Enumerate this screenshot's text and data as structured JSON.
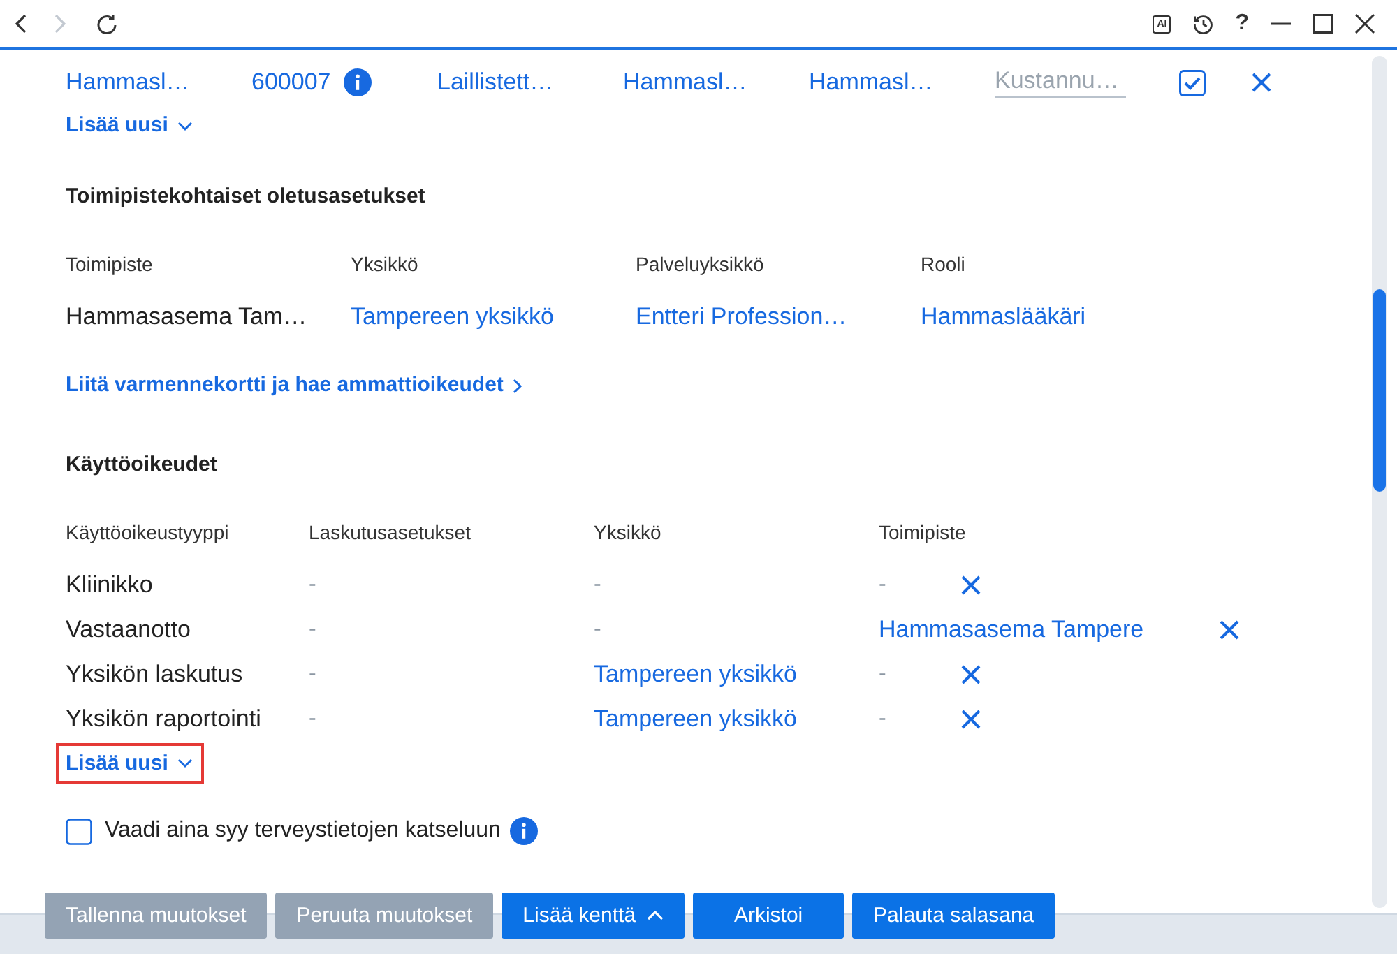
{
  "titlebar": {
    "nav": [
      {
        "kind": "back",
        "disabled": false
      },
      {
        "kind": "forward",
        "disabled": true
      },
      {
        "kind": "refresh",
        "disabled": false
      }
    ],
    "ai_label": "AI",
    "help": "?"
  },
  "top_row": {
    "cells": [
      {
        "text": "Hammasl…",
        "info": false
      },
      {
        "text": "600007",
        "info": true
      },
      {
        "text": "Laillistett…",
        "info": false
      },
      {
        "text": "Hammasl…",
        "info": false
      },
      {
        "text": "Hammasl…",
        "info": false
      }
    ],
    "field": {
      "placeholder": "Kustannu…"
    },
    "checked": true,
    "add_new": "Lisää uusi"
  },
  "default_settings": {
    "title": "Toimipistekohtaiset oletusasetukset",
    "columns": [
      "Toimipiste",
      "Yksikkö",
      "Palveluyksikkö",
      "Rooli"
    ],
    "values": [
      {
        "text": "Hammasasema Tam…",
        "kind": "plain"
      },
      {
        "text": "Tampereen yksikkö",
        "kind": "link"
      },
      {
        "text": "Entteri Profession…",
        "kind": "link"
      },
      {
        "text": "Hammaslääkäri",
        "kind": "link"
      }
    ],
    "link": "Liitä varmennekortti ja hae ammattioikeudet"
  },
  "access_rights": {
    "title": "Käyttöoikeudet",
    "columns": [
      "Käyttöoikeustyyppi",
      "Laskutusasetukset",
      "Yksikkö",
      "Toimipiste"
    ],
    "rows": [
      {
        "cells": [
          {
            "text": "Kliinikko",
            "kind": "plain"
          },
          {
            "text": "-",
            "kind": "dash"
          },
          {
            "text": "-",
            "kind": "dash"
          },
          {
            "text": "-",
            "kind": "dash"
          }
        ]
      },
      {
        "cells": [
          {
            "text": "Vastaanotto",
            "kind": "plain"
          },
          {
            "text": "-",
            "kind": "dash"
          },
          {
            "text": "-",
            "kind": "dash"
          },
          {
            "text": "Hammasasema Tampere",
            "kind": "link"
          }
        ]
      },
      {
        "cells": [
          {
            "text": "Yksikön laskutus",
            "kind": "plain"
          },
          {
            "text": "-",
            "kind": "dash"
          },
          {
            "text": "Tampereen yksikkö",
            "kind": "link"
          },
          {
            "text": "-",
            "kind": "dash"
          }
        ]
      },
      {
        "cells": [
          {
            "text": "Yksikön raportointi",
            "kind": "plain"
          },
          {
            "text": "-",
            "kind": "dash"
          },
          {
            "text": "Tampereen yksikkö",
            "kind": "link"
          },
          {
            "text": "-",
            "kind": "dash"
          }
        ]
      }
    ],
    "add_new": {
      "label": "Lisää uusi",
      "highlighted": true
    }
  },
  "require_reason": {
    "label": "Vaadi aina syy terveystietojen katseluun",
    "checked": false
  },
  "buttons": [
    {
      "label": "Tallenna muutokset",
      "disabled": true,
      "has_menu": false
    },
    {
      "label": "Peruuta muutokset",
      "disabled": true,
      "has_menu": false
    },
    {
      "label": "Lisää kenttä",
      "disabled": false,
      "has_menu": true
    },
    {
      "label": "Arkistoi",
      "disabled": false,
      "has_menu": false
    },
    {
      "label": "Palauta salasana",
      "disabled": false,
      "has_menu": false
    }
  ]
}
